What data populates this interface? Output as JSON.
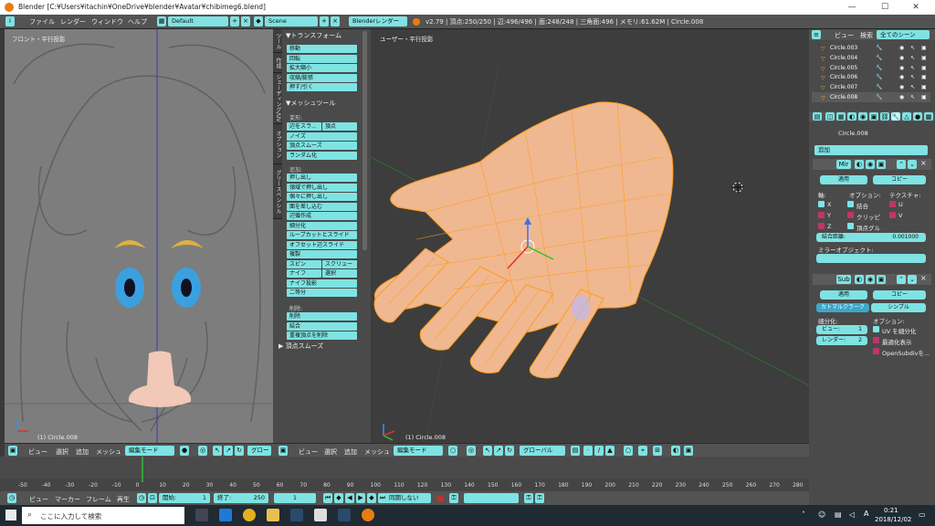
{
  "window": {
    "title": "Blender [C:¥Users¥itachin¥OneDrive¥blender¥Avatar¥chibimeg6.blend]",
    "minimize": "—",
    "maximize": "☐",
    "close": "✕"
  },
  "menubar": {
    "items": [
      "ファイル",
      "レンダー",
      "ウィンドウ",
      "ヘルプ"
    ],
    "layout": "Default",
    "scene": "Scene",
    "engine": "Blenderレンダー",
    "stats": "v2.79 | 頂点:250/250 | 辺:496/496 | 面:248/248 | 三角面:496 | メモリ:61.62M | Circle.008"
  },
  "left_view": {
    "label": "フロント・平行投影",
    "object": "(1) Circle.008"
  },
  "main_view": {
    "label": "ユーザー・平行投影",
    "object": "(1) Circle.008"
  },
  "toolshelf": {
    "tabs": [
      "ツール",
      "作成",
      "シェーディング/UV",
      "オプション",
      "グリースペンシル"
    ],
    "transform_header": "▼トランスフォーム",
    "transform_buttons": [
      "移動",
      "回転",
      "拡大縮小",
      "収縮/膨張",
      "押す/引く"
    ],
    "meshtools_header": "▼メッシュツール",
    "deform_label": "変形:",
    "deform_rows": [
      [
        "辺をスラ...",
        "頂点"
      ],
      [
        "ノイズ"
      ],
      [
        "頂点スムーズ"
      ],
      [
        "ランダム化"
      ]
    ],
    "add_label": "追加:",
    "add_rows": [
      [
        "押し出し"
      ],
      [
        "領域で押し出し"
      ],
      [
        "個々に押し出し"
      ],
      [
        "面を差し込む"
      ],
      [
        "辺循作成"
      ],
      [
        "細分化"
      ],
      [
        "ループカットとスライド"
      ],
      [
        "オフセット辺スライド"
      ],
      [
        "複製"
      ],
      [
        "スピン",
        "スクリュー"
      ],
      [
        "ナイフ",
        "選択"
      ],
      [
        "ナイフ投影"
      ],
      [
        "二等分"
      ]
    ],
    "delete_label": "削除:",
    "delete_rows": [
      [
        "削除"
      ],
      [
        "結合"
      ],
      [
        "重複頂点を削除"
      ]
    ],
    "vertex_smooth": "▶ 頂点スムーズ"
  },
  "view_header": {
    "items": [
      "ビュー",
      "選択",
      "追加",
      "メッシュ"
    ],
    "mode": "編集モード",
    "orientation_left": "グロー",
    "orientation_main": "グローバル"
  },
  "timeline": {
    "ticks": [
      "-50",
      "-40",
      "-30",
      "-20",
      "-10",
      "0",
      "10",
      "20",
      "30",
      "40",
      "50",
      "60",
      "70",
      "80",
      "90",
      "100",
      "110",
      "120",
      "130",
      "140",
      "150",
      "160",
      "170",
      "180",
      "190",
      "200",
      "210",
      "220",
      "230",
      "240",
      "250",
      "260",
      "270",
      "280"
    ],
    "current_frame": 1,
    "menu": [
      "ビュー",
      "マーカー",
      "フレーム",
      "再生"
    ],
    "start": "開始:",
    "start_val": "1",
    "end": "終了:",
    "end_val": "250",
    "frame_val": "1",
    "sync": "同期しない"
  },
  "outliner": {
    "tabs": [
      "ビュー",
      "検索",
      "全てのシーン"
    ],
    "rows": [
      "Circle.003",
      "Circle.004",
      "Circle.005",
      "Circle.006",
      "Circle.007",
      "Circle.008"
    ]
  },
  "properties": {
    "object_name": "Circle.008",
    "add_modifier": "追加",
    "mirror": {
      "name": "Mir",
      "apply": "適用",
      "copy": "コピー",
      "axis_label": "軸:",
      "options_label": "オプション:",
      "texture_label": "テクスチャ:",
      "x": "X",
      "y": "Y",
      "z": "Z",
      "merge": "結合",
      "clipping": "クリッピ",
      "vertex_group": "頂点グル",
      "u": "U",
      "v": "V",
      "merge_dist_label": "結合距離:",
      "merge_dist": "0.001000",
      "mirror_object": "ミラーオブジェクト:"
    },
    "subsurf": {
      "name": "Sub",
      "apply": "適用",
      "copy": "コピー",
      "catmull": "カトマルクラーク",
      "simple": "シンプル",
      "subdiv_label": "細分化:",
      "options_label": "オプション:",
      "view_label": "ビュー:",
      "view_val": "1",
      "render_label": "レンダー:",
      "render_val": "2",
      "uv": "UV を細分化",
      "optimal": "最適化表示",
      "opensubdiv": "OpenSubdivを..."
    }
  },
  "taskbar": {
    "search": "ここに入力して検索",
    "time": "0:21",
    "date": "2018/12/02",
    "ime": "A"
  }
}
